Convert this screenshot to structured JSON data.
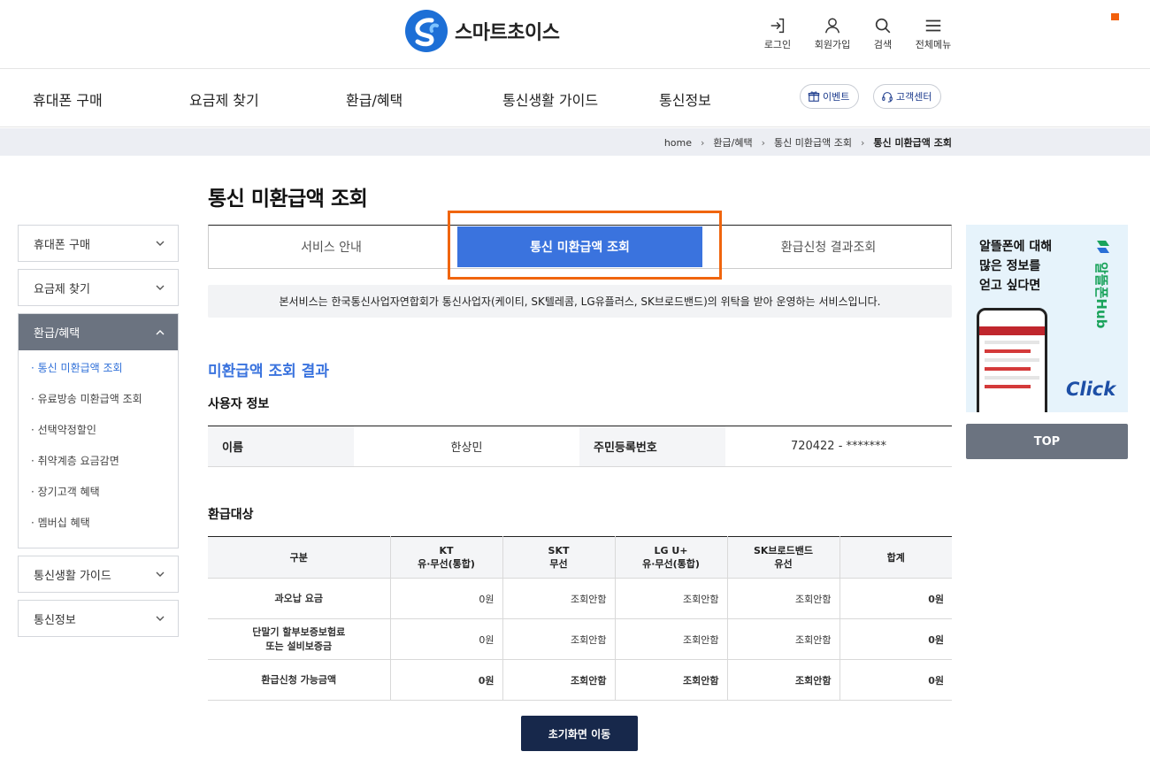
{
  "header": {
    "logo_text": "스마트초이스",
    "utils": [
      {
        "label": "로그인",
        "icon": "login-icon"
      },
      {
        "label": "회원가입",
        "icon": "user-icon"
      },
      {
        "label": "검색",
        "icon": "search-icon"
      },
      {
        "label": "전체메뉴",
        "icon": "menu-icon"
      }
    ]
  },
  "gnb": {
    "items": [
      "휴대폰 구매",
      "요금제 찾기",
      "환급/혜택",
      "통신생활 가이드",
      "통신정보"
    ],
    "event_label": "이벤트",
    "support_label": "고객센터"
  },
  "breadcrumb": [
    "home",
    "환급/혜택",
    "통신 미환급액 조회",
    "통신 미환급액 조회"
  ],
  "page_title": "통신 미환급액 조회",
  "sidebar": {
    "sections": [
      {
        "label": "휴대폰 구매"
      },
      {
        "label": "요금제 찾기"
      },
      {
        "label": "환급/혜택",
        "sub": [
          "· 통신 미환급액 조회",
          "· 유료방송 미환급액 조회",
          "· 선택약정할인",
          "· 취약계층 요금감면",
          "· 장기고객 혜택",
          "· 멤버십 혜택"
        ]
      },
      {
        "label": "통신생활 가이드"
      },
      {
        "label": "통신정보"
      }
    ]
  },
  "tabs": [
    "서비스 안내",
    "통신 미환급액 조회",
    "환급신청 결과조회"
  ],
  "notice": "본서비스는 한국통신사업자연합회가 통신사업자(케이티, SK텔레콤, LG유플러스, SK브로드밴드)의 위탁을 받아 운영하는 서비스입니다.",
  "result": {
    "title": "미환급액 조회 결과",
    "user_section": "사용자 정보",
    "name_label": "이름",
    "name_value": "한상민",
    "rrn_label": "주민등록번호",
    "rrn_value": "720422 - *******",
    "refund_section": "환급대상",
    "table": {
      "headers": [
        {
          "line1": "구분",
          "line2": ""
        },
        {
          "line1": "KT",
          "line2": "유·무선(통합)"
        },
        {
          "line1": "SKT",
          "line2": "무선"
        },
        {
          "line1": "LG U+",
          "line2": "유·무선(통합)"
        },
        {
          "line1": "SK브로드밴드",
          "line2": "유선"
        },
        {
          "line1": "합계",
          "line2": ""
        }
      ],
      "rows": [
        {
          "label1": "과오납 요금",
          "label2": "",
          "values": [
            "0원",
            "조회안함",
            "조회안함",
            "조회안함",
            "0원"
          ]
        },
        {
          "label1": "단말기 할부보증보험료",
          "label2": "또는 설비보증금",
          "values": [
            "0원",
            "조회안함",
            "조회안함",
            "조회안함",
            "0원"
          ]
        },
        {
          "label1": "환급신청 가능금액",
          "label2": "",
          "values": [
            "0원",
            "조회안함",
            "조회안함",
            "조회안함",
            "0원"
          ]
        }
      ]
    },
    "home_button": "초기화면 이동"
  },
  "banner": {
    "text": "알뜰폰에 대해\n많은 정보를\n얻고 싶다면",
    "brand": "알뜰폰Hub",
    "cta": "Click"
  },
  "top_button": "TOP"
}
